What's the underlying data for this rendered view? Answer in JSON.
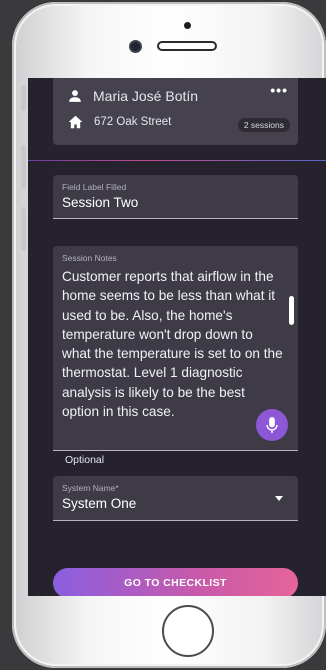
{
  "customer": {
    "name": "Maria José Botín",
    "address": "672 Oak Street",
    "sessions_badge": "2 sessions",
    "more_label": "•••"
  },
  "session_name_field": {
    "label": "Field Label Filled",
    "value": "Session Two"
  },
  "session_notes_field": {
    "label": "Session Notes",
    "value": "Customer reports that airflow in the home seems to be less than what it used to be. Also, the home's temperature won't drop down to what the temperature is set to on the thermostat. Level 1 diagnostic analysis is likely to be the best option in this case.",
    "helper": "Optional"
  },
  "system_field": {
    "label": "System Name*",
    "value": "System One"
  },
  "checklist_button": {
    "label": "GO TO CHECKLIST"
  },
  "colors": {
    "background": "#25222e",
    "field": "#3e3b47",
    "accent_start": "#8a5ee0",
    "accent_end": "#e6649a",
    "mic": "#8e57d6"
  },
  "icons": [
    "person-icon",
    "home-icon",
    "more-icon",
    "microphone-icon",
    "dropdown-caret-icon"
  ]
}
